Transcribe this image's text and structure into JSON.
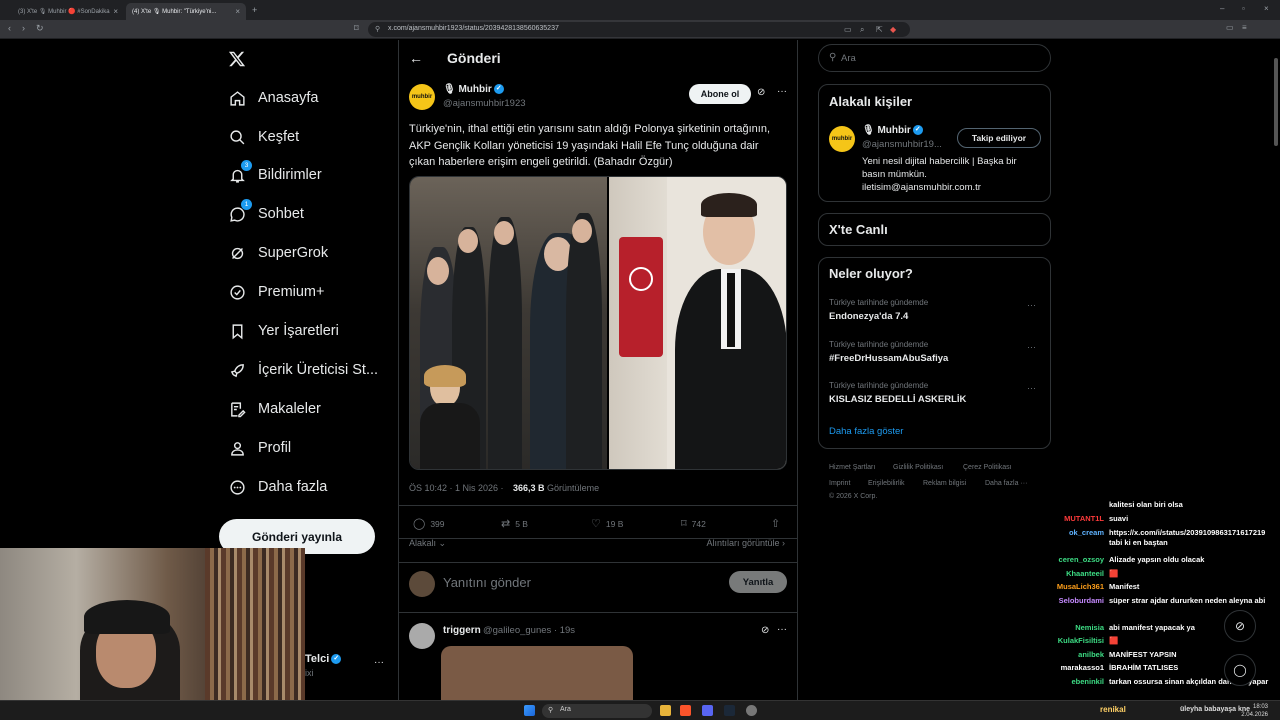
{
  "browser": {
    "tabs": [
      {
        "label": "(3) X'te 🎙 Muhbir 🔴 #SonDakika"
      },
      {
        "label": "(4) X'te 🎙 Muhbir: \"Türkiye'ni..."
      }
    ],
    "url": "x.com/ajansmuhbir1923/status/2039428138560635237"
  },
  "nav": {
    "items": [
      {
        "label": "Anasayfa"
      },
      {
        "label": "Keşfet"
      },
      {
        "label": "Bildirimler",
        "badge": "3"
      },
      {
        "label": "Sohbet",
        "badge": "1"
      },
      {
        "label": "SuperGrok"
      },
      {
        "label": "Premium+"
      },
      {
        "label": "Yer İşaretleri"
      },
      {
        "label": "İçerik Üreticisi St..."
      },
      {
        "label": "Makaleler"
      },
      {
        "label": "Profil"
      },
      {
        "label": "Daha fazla"
      }
    ],
    "post_button": "Gönderi yayınla",
    "account": {
      "name": "Telci",
      "handle": "ixi"
    }
  },
  "header": {
    "title": "Gönderi"
  },
  "tweet": {
    "avatar_text": "muhbir",
    "author": "🎙 Muhbir",
    "handle": "@ajansmuhbir1923",
    "subscribe": "Abone ol",
    "text": "Türkiye'nin, ithal ettiği etin yarısını satın aldığı Polonya şirketinin ortağının, AKP Gençlik Kolları yöneticisi 19 yaşındaki Halil Efe Tunç olduğuna dair çıkan haberlere erişim engeli getirildi. (Bahadır Özgür)",
    "time": "ÖS 10:42 · 1 Nis 2026 ·",
    "views": "366,3 B",
    "views_label": "Görüntüleme",
    "replies": "399",
    "reposts": "5 B",
    "likes": "19 B",
    "bookmarks": "742",
    "relevance": "Alakalı",
    "quotes_link": "Alıntıları görüntüle"
  },
  "reply": {
    "placeholder": "Yanıtını gönder",
    "button": "Yanıtla"
  },
  "next_tweet": {
    "name": "triggern",
    "handle": "@galileo_gunes · 19s"
  },
  "sidebar": {
    "search_placeholder": "Ara",
    "relevant": {
      "title": "Alakalı kişiler",
      "avatar_text": "muhbir",
      "name": "🎙 Muhbir",
      "handle": "@ajansmuhbir19...",
      "follow": "Takip ediliyor",
      "bio": "Yeni nesil dijital habercilik | Başka bir basın mümkün. iletisim@ajansmuhbir.com.tr"
    },
    "live_title": "X'te Canlı",
    "trends": {
      "title": "Neler oluyor?",
      "items": [
        {
          "context": "Türkiye tarihinde gündemde",
          "name": "Endonezya'da 7.4"
        },
        {
          "context": "Türkiye tarihinde gündemde",
          "name": "#FreeDrHussamAbuSafiya"
        },
        {
          "context": "Türkiye tarihinde gündemde",
          "name": "KISLASIZ BEDELLİ ASKERLİK"
        }
      ],
      "show_more": "Daha fazla göster"
    },
    "footer": [
      "Hizmet Şartları",
      "Gizlilik Politikası",
      "Çerez Politikası",
      "Imprint",
      "Erişilebilirlik",
      "Reklam bilgisi",
      "Daha fazla ···",
      "© 2026 X Corp."
    ]
  },
  "chat": [
    {
      "user": "",
      "msg": "kalitesi olan biri olsa",
      "color": "#ffffff"
    },
    {
      "user": "MUTANT1L",
      "msg": "suavi",
      "color": "#ff3b3b"
    },
    {
      "user": "ok_cream",
      "msg": "https://x.com/i/status/2039109863171617219 tabi ki en baştan",
      "color": "#5fb3ff"
    },
    {
      "user": "ceren_ozsoy",
      "msg": "Alizade yapsın oldu olacak",
      "color": "#3ddc84"
    },
    {
      "user": "Khaanteeil",
      "msg": "🟥",
      "color": "#3ddc84"
    },
    {
      "user": "MusaLich361",
      "msg": "Manifest",
      "color": "#ff9f1a"
    },
    {
      "user": "Seloburdami",
      "msg": "süper strar ajdar dururken neden aleyna abi",
      "color": "#c58aff"
    },
    {
      "user": "Nemisia",
      "msg": "abi manifest yapacak ya",
      "color": "#3ddc84"
    },
    {
      "user": "KulakFisiltisi",
      "msg": "🟥",
      "color": "#3ddc84"
    },
    {
      "user": "anilbek",
      "msg": "MANİFEST YAPSIN",
      "color": "#3ddc84"
    },
    {
      "user": "marakasso1",
      "msg": "İBRAHİM TATLISES",
      "color": "#ffffff"
    },
    {
      "user": "ebeninkil",
      "msg": "tarkan ossursa sinan akçıldan daha iyi yapar",
      "color": "#3ddc84"
    },
    {
      "user": "renikal",
      "msg": "üleyha babayaşa kne",
      "color": "#ffd166"
    }
  ],
  "taskbar": {
    "search": "Ara",
    "time": "18:03",
    "date": "2.04.2026"
  }
}
